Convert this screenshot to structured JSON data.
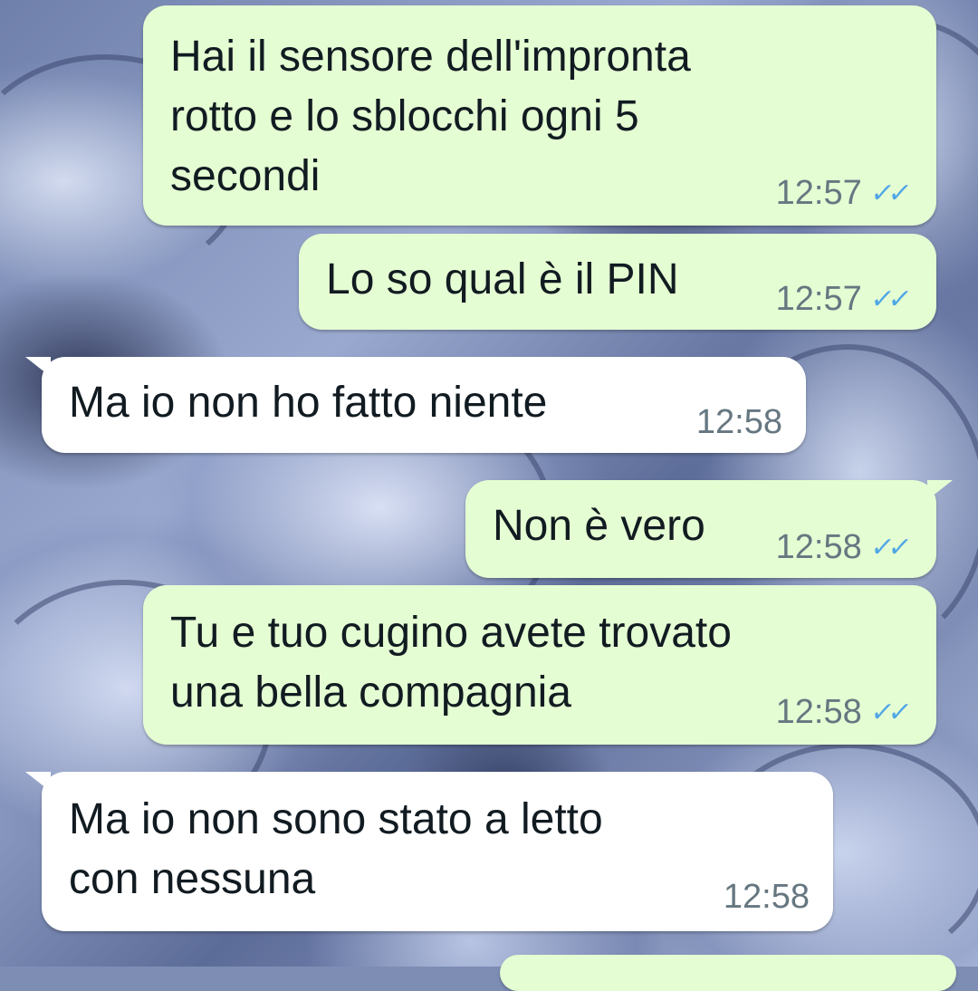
{
  "messages": [
    {
      "direction": "outgoing",
      "text": "Hai il sensore dell'impronta\nrotto e lo sblocchi ogni 5\nsecondi",
      "time": "12:57",
      "status_icon": "double-check-read-icon"
    },
    {
      "direction": "outgoing",
      "text": "Lo so qual è il PIN",
      "time": "12:57",
      "status_icon": "double-check-read-icon"
    },
    {
      "direction": "incoming",
      "text": "Ma io non ho fatto niente",
      "time": "12:58"
    },
    {
      "direction": "outgoing",
      "text": "Non è vero",
      "time": "12:58",
      "status_icon": "double-check-read-icon"
    },
    {
      "direction": "outgoing",
      "text": "Tu e tuo cugino avete trovato\nuna bella compagnia",
      "time": "12:58",
      "status_icon": "double-check-read-icon"
    },
    {
      "direction": "incoming",
      "text": "Ma io non sono stato a letto\ncon nessuna",
      "time": "12:58"
    }
  ],
  "colors": {
    "outgoing_bubble": "#e5fdd3",
    "incoming_bubble": "#ffffff",
    "read_ticks": "#4fa6e6",
    "timestamp": "#667781"
  },
  "ticks_glyph": "✓✓"
}
